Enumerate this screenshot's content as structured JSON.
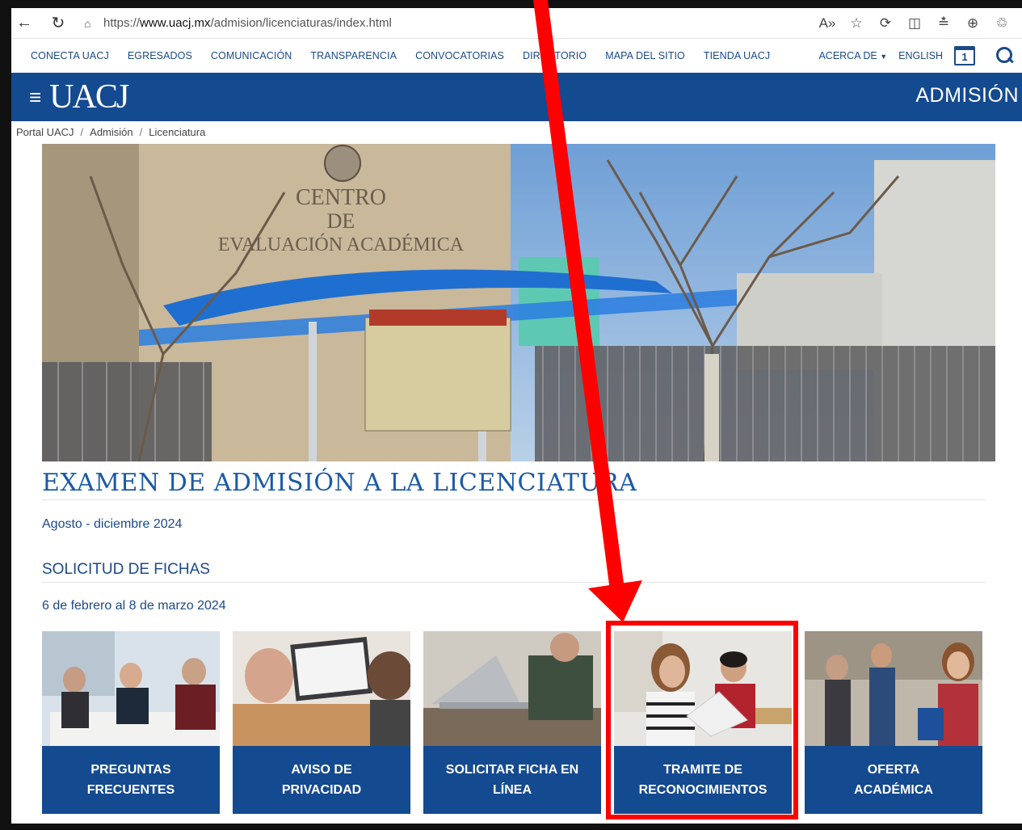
{
  "browser": {
    "url_prefix": "https://",
    "url_host": "www.uacj.mx",
    "url_path": "/admision/licenciaturas/index.html"
  },
  "utility_nav": {
    "links": [
      "CONECTA UACJ",
      "EGRESADOS",
      "COMUNICACIÓN",
      "TRANSPARENCIA",
      "CONVOCATORIAS",
      "DIRECTORIO",
      "MAPA DEL SITIO",
      "TIENDA UACJ"
    ],
    "about": "ACERCA DE",
    "english": "ENGLISH",
    "calendar_number": "1"
  },
  "header": {
    "menu_glyph": "≡",
    "logo": "UACJ",
    "section": "ADMISIÓN"
  },
  "breadcrumb": [
    "Portal UACJ",
    "Admisión",
    "Licenciatura"
  ],
  "hero": {
    "sign_line1": "CENTRO",
    "sign_line2": "DE",
    "sign_line3": "EVALUACIÓN   ACADÉMICA"
  },
  "content": {
    "title": "EXAMEN DE ADMISIÓN A LA LICENCIATURA",
    "period": "Agosto - diciembre 2024",
    "subtitle": "SOLICITUD DE FICHAS",
    "dates": "6 de febrero al 8 de marzo 2024"
  },
  "cards": [
    {
      "line1": "PREGUNTAS",
      "line2": "FRECUENTES"
    },
    {
      "line1": "AVISO DE",
      "line2": "PRIVACIDAD"
    },
    {
      "line1": "SOLICITAR FICHA EN",
      "line2": "LÍNEA"
    },
    {
      "line1": "TRAMITE DE",
      "line2": "RECONOCIMIENTOS"
    },
    {
      "line1": "OFERTA",
      "line2": "ACADÉMICA"
    }
  ],
  "colors": {
    "brand_blue": "#144a8f",
    "annotation_red": "#ff0000"
  }
}
